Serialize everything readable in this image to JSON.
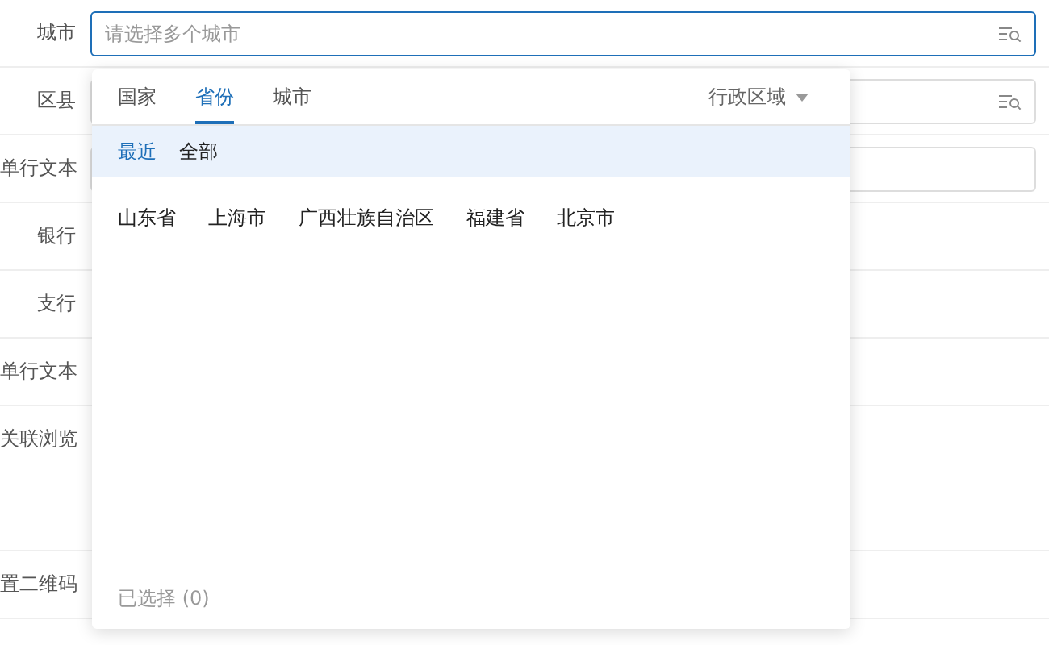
{
  "form_rows": [
    {
      "label": "城市",
      "field": {
        "kind": "search",
        "placeholder": "请选择多个城市",
        "focused": true
      }
    },
    {
      "label": "区县",
      "field": {
        "kind": "search",
        "focused": false
      }
    },
    {
      "label": "单行文本",
      "field": {
        "kind": "text",
        "focused": false
      }
    },
    {
      "label": "银行"
    },
    {
      "label": "支行"
    },
    {
      "label": "单行文本"
    },
    {
      "label": "关联浏览",
      "tall": true
    },
    {
      "label": "置二维码"
    }
  ],
  "dropdown": {
    "tabs": [
      {
        "label": "国家",
        "selected": false
      },
      {
        "label": "省份",
        "selected": true
      },
      {
        "label": "城市",
        "selected": false
      }
    ],
    "region_select": "行政区域",
    "filters": [
      {
        "label": "最近",
        "selected": true
      },
      {
        "label": "全部",
        "selected": false
      }
    ],
    "options": [
      "山东省",
      "上海市",
      "广西壮族自治区",
      "福建省",
      "北京市"
    ],
    "selected_count": "已选择 (0)"
  }
}
